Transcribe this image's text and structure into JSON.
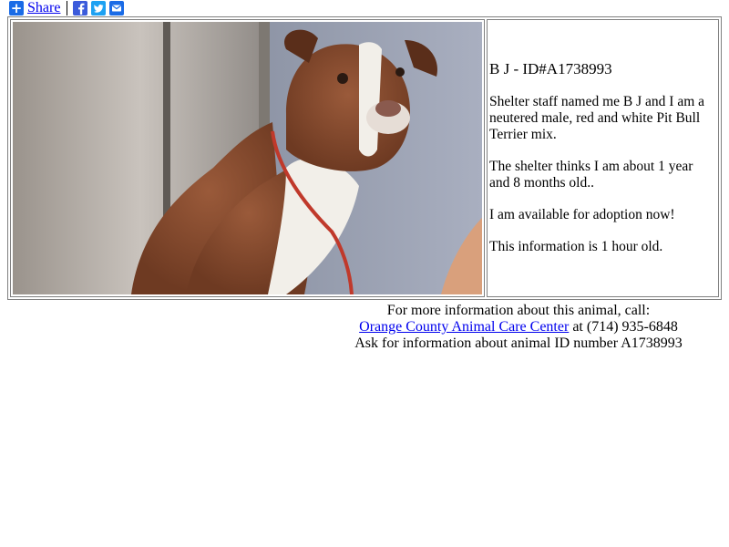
{
  "share": {
    "label": "Share",
    "icons": [
      "plus-icon",
      "facebook-icon",
      "twitter-icon",
      "email-icon"
    ]
  },
  "animal": {
    "title": "B J - ID#A1738993",
    "description": "Shelter staff named me B J and I am a neutered male, red and white Pit Bull Terrier mix.",
    "age": "The shelter thinks I am about 1 year and 8 months old..",
    "availability": "I am available for adoption now!",
    "freshness": "This information is 1 hour old."
  },
  "contact": {
    "intro": "For more information about this animal, call:",
    "shelter_name": "Orange County Animal Care Center",
    "phone_text": " at (714) 935-6848",
    "ask_text": "Ask for information about animal ID number A1738993"
  },
  "colors": {
    "link": "#0000ee",
    "share_blue": "#1a6be6",
    "facebook": "#3b5bdb",
    "twitter": "#1da1f2",
    "border": "#808080"
  }
}
